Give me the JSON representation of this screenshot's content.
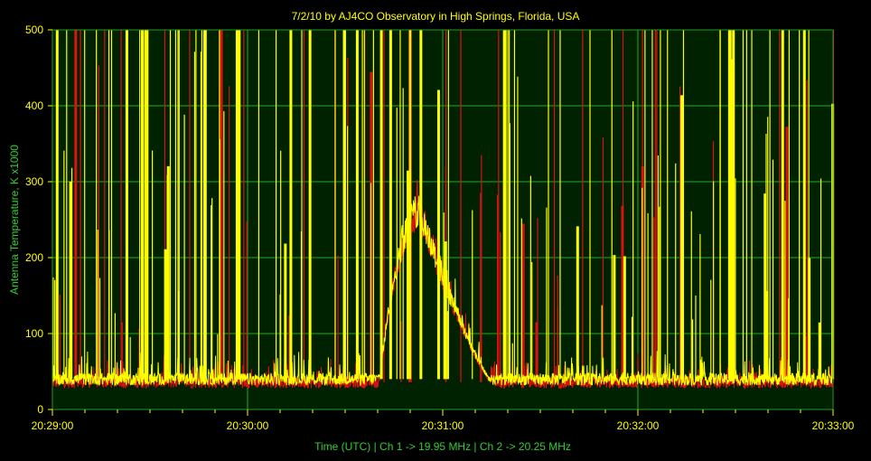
{
  "chart_data": {
    "type": "line",
    "title": "7/2/10  by  AJ4CO Observatory  in  High Springs, Florida, USA",
    "xlabel": "Time (UTC)  |  Ch 1 -> 19.95 MHz  |  Ch 2 -> 20.25 MHz",
    "ylabel": "Antenna Temperature, K x1000",
    "x_ticks": [
      "20:29:00",
      "20:30:00",
      "20:31:00",
      "20:32:00",
      "20:33:00"
    ],
    "y_ticks": [
      "0",
      "100",
      "200",
      "300",
      "400",
      "500"
    ],
    "xlim_seconds_after_2029": [
      0,
      240
    ],
    "ylim": [
      0,
      500
    ],
    "grid": true,
    "colors": {
      "background": "#000000",
      "plot_background": "#002200",
      "grid": "#22aa22",
      "frame": "#229922",
      "series_1": "#ffff00",
      "series_2": "#dd1111",
      "label": "#33cc33"
    },
    "series": [
      {
        "name": "Ch 1 -> 19.95 MHz",
        "color": "#ffff00",
        "baseline": 40,
        "burst": {
          "start_s": 100,
          "peak_s": 113,
          "end_s": 140,
          "peak_value": 250
        },
        "spikes_approx": 150
      },
      {
        "name": "Ch 2 -> 20.25 MHz",
        "color": "#dd1111",
        "baseline": 36,
        "burst": {
          "start_s": 100,
          "peak_s": 113,
          "end_s": 140,
          "peak_value": 245
        },
        "spikes_approx": 60
      }
    ]
  }
}
